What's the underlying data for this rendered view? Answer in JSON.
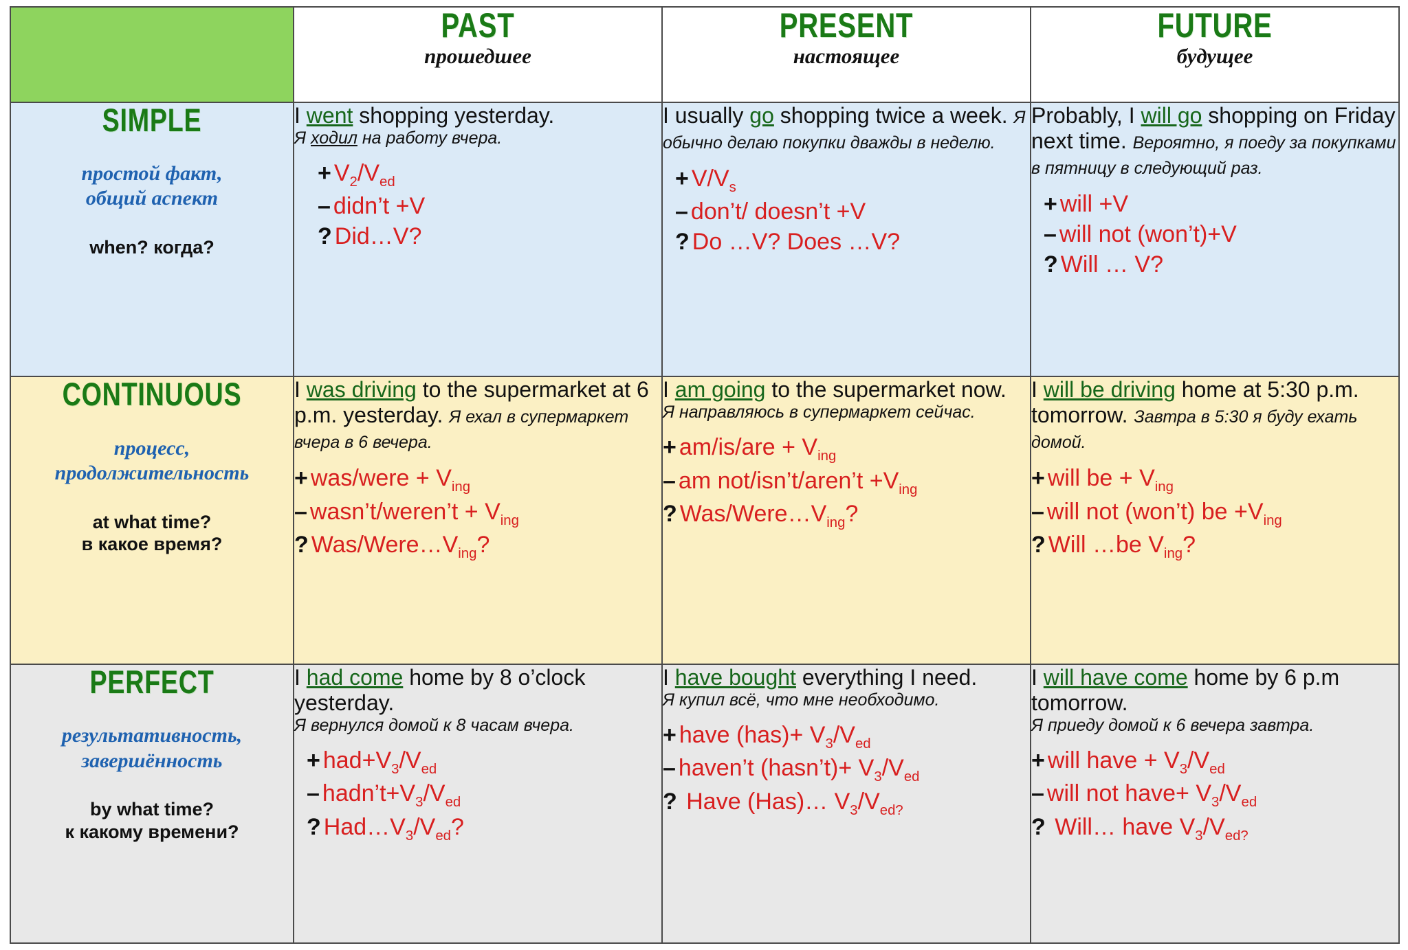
{
  "table": {
    "columns": [
      {
        "en": "PAST",
        "ru": "прошедшее"
      },
      {
        "en": "PRESENT",
        "ru": "настоящее"
      },
      {
        "en": "FUTURE",
        "ru": "будущее"
      }
    ],
    "rows": [
      {
        "aspect": "SIMPLE",
        "subtitle_line1": "простой факт,",
        "subtitle_line2": "общий аспект",
        "question": "when? когда?",
        "bg": "#dbeaf7",
        "cells": [
          {
            "en_pre": "I ",
            "en_hl": "went",
            "en_post": " shopping yesterday.",
            "ru_pre": "Я ",
            "ru_hl": "ходил",
            "ru_post": " на работу вчера.",
            "formulas": [
              {
                "sign": "+",
                "text": "V2/Ved"
              },
              {
                "sign": "–",
                "text": "didn’t +V"
              },
              {
                "sign": "?",
                "text": "Did…V?"
              }
            ]
          },
          {
            "en_pre": "I usually ",
            "en_hl": "go",
            "en_post": " shopping twice a week.",
            "ru_pre": "",
            "ru_hl": "",
            "ru_post": "Я обычно делаю покупки дважды в неделю.",
            "formulas": [
              {
                "sign": "+",
                "text": "V/Vs"
              },
              {
                "sign": "–",
                "text": "don’t/ doesn’t +V"
              },
              {
                "sign": "?",
                "text": "Do …V? Does …V?"
              }
            ]
          },
          {
            "en_pre": "Probably, I ",
            "en_hl": "will go",
            "en_post": " shopping on Friday next time.",
            "ru_pre": "",
            "ru_hl": "",
            "ru_post": "Вероятно, я поеду за покупками в пятницу в следующий раз.",
            "formulas": [
              {
                "sign": "+",
                "text": "will +V"
              },
              {
                "sign": "–",
                "text": "will not (won’t)+V"
              },
              {
                "sign": "?",
                "text": "Will … V?"
              }
            ]
          }
        ]
      },
      {
        "aspect": "CONTINUOUS",
        "subtitle_line1": "процесс,",
        "subtitle_line2": "продолжительность",
        "question_line1": "at what time?",
        "question_line2": "в какое время?",
        "bg": "#fbf0c4",
        "cells": [
          {
            "en_pre": "I ",
            "en_hl": "was driving",
            "en_post": " to the supermarket at 6 p.m. yesterday.",
            "ru_post": "Я ехал в супермаркет вчера в 6 вечера.",
            "formulas": [
              {
                "sign": "+",
                "text": "was/were + Ving"
              },
              {
                "sign": "–",
                "text": "wasn’t/weren’t + Ving"
              },
              {
                "sign": "?",
                "text": "Was/Were…Ving?"
              }
            ]
          },
          {
            "en_pre": "I ",
            "en_hl": "am going",
            "en_post": " to the supermarket now.",
            "ru_post": "Я направляюсь в супермаркет сейчас.",
            "formulas": [
              {
                "sign": "+",
                "text": "am/is/are + Ving"
              },
              {
                "sign": "–",
                "text": "am not/isn’t/aren’t +Ving"
              },
              {
                "sign": "?",
                "text": "Was/Were…Ving?"
              }
            ]
          },
          {
            "en_pre": "I ",
            "en_hl": "will be driving",
            "en_post": " home at 5:30 p.m. tomorrow.",
            "ru_post": "Завтра в 5:30 я буду ехать домой.",
            "formulas": [
              {
                "sign": "+",
                "text": "will be + Ving"
              },
              {
                "sign": "–",
                "text": "will not (won’t) be +Ving"
              },
              {
                "sign": "?",
                "text": "Will …be Ving?"
              }
            ]
          }
        ]
      },
      {
        "aspect": "PERFECT",
        "subtitle_line1": "результативность,",
        "subtitle_line2": "завершённость",
        "question_line1": "by what time?",
        "question_line2": "к какому времени?",
        "bg": "#e8e8e8",
        "cells": [
          {
            "en_pre": "I ",
            "en_hl": "had come",
            "en_post": " home by 8 o’clock yesterday.",
            "ru_post": "Я вернулся домой к 8 часам вчера.",
            "formulas": [
              {
                "sign": "+",
                "text": "had+V3/Ved"
              },
              {
                "sign": "–",
                "text": "hadn’t+V3/Ved"
              },
              {
                "sign": "?",
                "text": "Had…V3/Ved?"
              }
            ]
          },
          {
            "en_pre": "I ",
            "en_hl": "have bought",
            "en_post": " everything I need.",
            "ru_post": "Я купил всё, что мне необходимо.",
            "formulas": [
              {
                "sign": "+",
                "text": "have (has)+ V3/Ved"
              },
              {
                "sign": "–",
                "text": "haven’t (hasn’t)+ V3/Ved"
              },
              {
                "sign": "?",
                "text": "Have (Has)… V3/Ved?"
              }
            ]
          },
          {
            "en_pre": "I ",
            "en_hl": "will have come",
            "en_post": " home by 6 p.m tomorrow.",
            "ru_post": "Я приеду домой к 6 вечера завтра.",
            "formulas": [
              {
                "sign": "+",
                "text": "will have + V3/Ved"
              },
              {
                "sign": "–",
                "text": "will not have+ V3/Ved"
              },
              {
                "sign": "?",
                "text": "Will… have V3/Ved?"
              }
            ]
          }
        ]
      }
    ]
  },
  "colors": {
    "header_green": "#1a7a16",
    "corner_green": "#8ed45e",
    "formula_red": "#d81f1f",
    "subtitle_blue": "#1f62b0",
    "highlight_green": "#16661a",
    "row_simple_bg": "#dbeaf7",
    "row_continuous_bg": "#fbf0c4",
    "row_perfect_bg": "#e8e8e8"
  }
}
